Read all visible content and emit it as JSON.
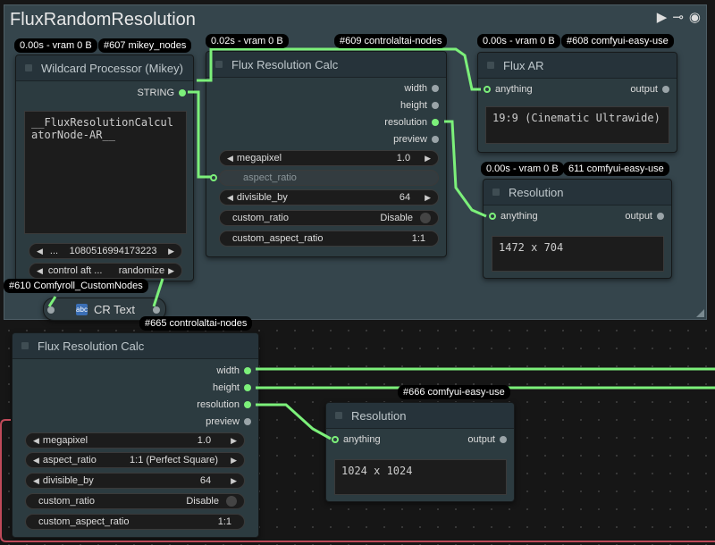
{
  "group": {
    "title": "FluxRandomResolution"
  },
  "icons": {
    "play": "play-icon",
    "link": "link-icon",
    "eye": "eye-icon"
  },
  "colors": {
    "link": "#7cf07a",
    "background": "#161616",
    "group": "#35454c",
    "node": "#2c3b40"
  },
  "nodes": {
    "wildcard": {
      "badge_time": "0.00s - vram 0 B",
      "badge_id": "#607 mikey_nodes",
      "title": "Wildcard Processor (Mikey)",
      "output": "STRING",
      "text": "__FluxResolutionCalculatorNode-AR__",
      "seed": {
        "prefix": "...",
        "value": "1080516994173223"
      },
      "control": {
        "label": "control aft ...",
        "value": "randomize"
      }
    },
    "calc609": {
      "badge_time": "0.02s - vram 0 B",
      "badge_id": "#609 controlaltai-nodes",
      "title": "Flux Resolution Calc",
      "outputs": [
        "width",
        "height",
        "resolution",
        "preview"
      ],
      "megapixel": {
        "label": "megapixel",
        "value": "1.0"
      },
      "aspect_ratio": {
        "label": "aspect_ratio"
      },
      "divisible_by": {
        "label": "divisible_by",
        "value": "64"
      },
      "custom_ratio": {
        "label": "custom_ratio",
        "value": "Disable"
      },
      "custom_aspect_ratio": {
        "label": "custom_aspect_ratio",
        "value": "1:1"
      }
    },
    "fluxar": {
      "badge_time": "0.00s - vram 0 B",
      "badge_id": "#608 comfyui-easy-use",
      "title": "Flux AR",
      "input": "anything",
      "output": "output",
      "text": "19:9 (Cinematic Ultrawide)"
    },
    "res611": {
      "badge_time": "0.00s - vram 0 B",
      "badge_id": "611 comfyui-easy-use",
      "title": "Resolution",
      "input": "anything",
      "output": "output",
      "text": "1472 x 704"
    },
    "crtext": {
      "badge_id": "#610 Comfyroll_CustomNodes",
      "title": "CR Text",
      "icon_label": "abc"
    },
    "calc665": {
      "badge_id": "#665 controlaltai-nodes",
      "title": "Flux Resolution Calc",
      "outputs": [
        "width",
        "height",
        "resolution",
        "preview"
      ],
      "megapixel": {
        "label": "megapixel",
        "value": "1.0"
      },
      "aspect_ratio": {
        "label": "aspect_ratio",
        "value": "1:1 (Perfect Square)"
      },
      "divisible_by": {
        "label": "divisible_by",
        "value": "64"
      },
      "custom_ratio": {
        "label": "custom_ratio",
        "value": "Disable"
      },
      "custom_aspect_ratio": {
        "label": "custom_aspect_ratio",
        "value": "1:1"
      }
    },
    "res666": {
      "badge_id": "#666 comfyui-easy-use",
      "title": "Resolution",
      "input": "anything",
      "output": "output",
      "text": "1024 x 1024"
    }
  }
}
